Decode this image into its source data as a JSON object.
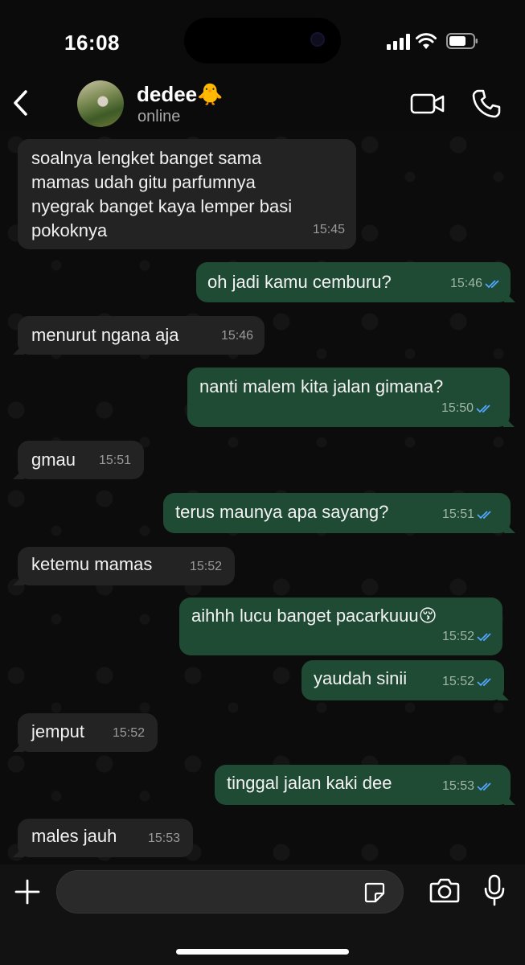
{
  "status_bar": {
    "time": "16:08"
  },
  "header": {
    "name": "dedee🐥",
    "status": "online"
  },
  "messages": [
    {
      "dir": "in",
      "text": "soalnya lengket banget sama\nmamas udah gitu parfumnya\nnyegrak banget kaya lemper basi\npokoknya",
      "time": "15:45"
    },
    {
      "dir": "out",
      "text": "oh jadi kamu cemburu?",
      "time": "15:46"
    },
    {
      "dir": "in",
      "text": "menurut ngana aja",
      "time": "15:46"
    },
    {
      "dir": "out",
      "text": "nanti malem kita jalan gimana?",
      "time": "15:50"
    },
    {
      "dir": "in",
      "text": "gmau",
      "time": "15:51"
    },
    {
      "dir": "out",
      "text": "terus maunya apa sayang?",
      "time": "15:51"
    },
    {
      "dir": "in",
      "text": "ketemu mamas",
      "time": "15:52"
    },
    {
      "dir": "out",
      "text": "aihhh lucu banget pacarkuuu😚",
      "time": "15:52"
    },
    {
      "dir": "out",
      "text": "yaudah sinii",
      "time": "15:52"
    },
    {
      "dir": "in",
      "text": "jemput",
      "time": "15:52"
    },
    {
      "dir": "out",
      "text": "tinggal jalan kaki dee",
      "time": "15:53"
    },
    {
      "dir": "in",
      "text": "males jauh",
      "time": "15:53"
    }
  ],
  "input": {
    "placeholder": ""
  },
  "colors": {
    "incoming_bubble": "#232323",
    "outgoing_bubble": "#1f4a34",
    "read_ticks": "#53a6ff"
  }
}
